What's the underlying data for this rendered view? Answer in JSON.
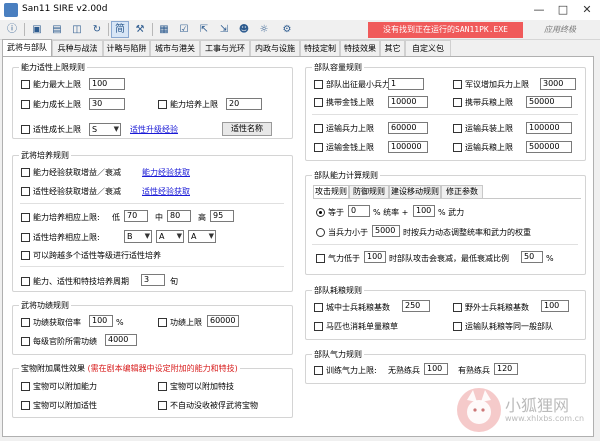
{
  "window": {
    "title": "San11 SIRE v2.00d"
  },
  "status_banner": "没有找到正在运行的SAN11PK.EXE",
  "author": "应用终极",
  "tabs": [
    "武将与部队",
    "兵种与战法",
    "计略与陷阱",
    "城市与港关",
    "工事与光环",
    "内政与设施",
    "特技定制",
    "特技效果",
    "其它",
    "自定义包"
  ],
  "growth": {
    "title": "能力适性上限规则",
    "max_limit_label": "能力最大上限",
    "max_limit_value": "100",
    "growth_cap_label": "能力成长上限",
    "growth_cap_value": "30",
    "train_cap_label": "能力培养上限",
    "train_cap_value": "20",
    "apt_cap_label": "适性成长上限",
    "apt_cap_value": "S",
    "apt_link": "适性升级经验",
    "apt_name_btn": "适性名称"
  },
  "train": {
    "title": "武将培养规则",
    "exp_gain_label": "能力经验获取增益／衰减",
    "exp_gain_link": "能力经验获取",
    "apt_gain_label": "适性经验获取增益／衰减",
    "apt_gain_link": "适性经验获取",
    "range_label": "能力培养相应上限:",
    "low_label": "低",
    "low_value": "70",
    "mid_label": "中",
    "mid_value": "80",
    "high_label": "高",
    "high_value": "95",
    "apt_range_label": "适性培养相应上限:",
    "apt_b1": "B",
    "apt_a1": "A",
    "apt_a2": "A",
    "cross_label": "可以跨越多个适性等级进行适性培养",
    "cycle_label": "能力、适性和特技培养周期",
    "cycle_value": "3",
    "cycle_unit": "旬"
  },
  "merit": {
    "title": "武将功绩规则",
    "rate_label": "功绩获取倍率",
    "rate_value": "100",
    "rate_unit": "%",
    "cap_label": "功绩上限",
    "cap_value": "60000",
    "rank_label": "每级官阶所需功绩",
    "rank_value": "4000"
  },
  "treasure": {
    "title": "宝物附加属性效果",
    "note": "(需在剧本编辑器中设定附加的能力和特技)",
    "ability_label": "宝物可以附加能力",
    "skill_label": "宝物可以附加特技",
    "apt_label": "宝物可以附加适性",
    "no_drop_label": "不自动没收被俘武将宝物"
  },
  "capacity": {
    "title": "部队容量规则",
    "min_troops_label": "部队出征最小兵力",
    "min_troops_value": "1",
    "max_troops_label": "军议增加兵力上限",
    "max_troops_value": "3000",
    "gold_label": "携带金钱上限",
    "gold_value": "10000",
    "food_label": "携带兵粮上限",
    "food_value": "50000",
    "transport_troops_label": "运输兵力上限",
    "transport_troops_value": "60000",
    "transport_arms_label": "运输兵装上限",
    "transport_arms_value": "100000",
    "transport_gold_label": "运输金钱上限",
    "transport_gold_value": "100000",
    "transport_food_label": "运输兵粮上限",
    "transport_food_value": "500000"
  },
  "calc": {
    "title": "部队能力计算规则",
    "subtabs": [
      "攻击规则",
      "防御规则",
      "建设移动规则",
      "修正参数"
    ],
    "eq_label": "等于",
    "eq_value": "0",
    "eq_mid": "% 统率 +",
    "eq_value2": "100",
    "eq_end": "% 武力",
    "radio2_a": "当兵力小于",
    "radio2_value": "5000",
    "radio2_b": "时按兵力动态调整统率和武力的权重",
    "morale_a": "气力低于",
    "morale_value": "100",
    "morale_b": "时部队攻击会衰减，最低衰减比例",
    "morale_pct": "50",
    "morale_unit": "%"
  },
  "consume": {
    "title": "部队耗粮规则",
    "city_label": "城中士兵耗粮基数",
    "city_value": "250",
    "field_label": "野外士兵耗粮基数",
    "field_value": "100",
    "horse_label": "马匹也消耗单量粮草",
    "transport_label": "运输队耗粮等同一般部队"
  },
  "morale": {
    "title": "部队气力规则",
    "train_label": "训练气力上限:",
    "untrained_label": "无熟练兵",
    "untrained_value": "100",
    "trained_label": "有熟练兵",
    "trained_value": "120"
  },
  "watermark": {
    "name": "小狐狸网",
    "url": "www.xhlxbs.com.cn"
  },
  "colors": {
    "banner": "#f05a5a",
    "link": "#1a1ad6",
    "note": "#d81e1e"
  }
}
